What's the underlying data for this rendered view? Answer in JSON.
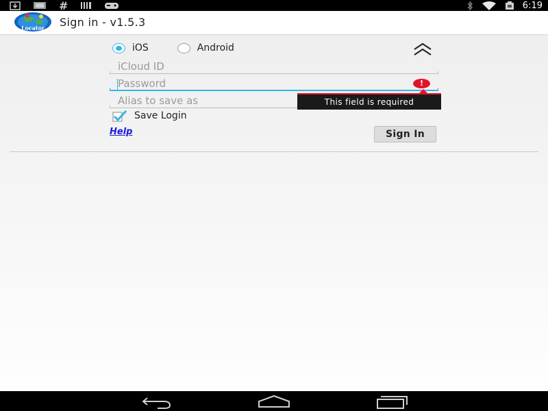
{
  "status_bar": {
    "time": "6:19",
    "left_icons": [
      "download-icon",
      "image-icon",
      "hash-icon",
      "barcode-icon",
      "gamepad-icon"
    ],
    "right_icons": [
      "bluetooth-icon",
      "wifi-icon",
      "battery-icon"
    ]
  },
  "action_bar": {
    "logo_icon": "locator-globe-icon",
    "logo_text": "Locator",
    "title": "Sign in - v1.5.3"
  },
  "form": {
    "platform_options": [
      {
        "label": "iOS",
        "selected": true
      },
      {
        "label": "Android",
        "selected": false
      }
    ],
    "icloud_id": {
      "placeholder": "iCloud ID",
      "value": ""
    },
    "password": {
      "placeholder": "Password",
      "value": "",
      "focused": true
    },
    "alias": {
      "placeholder": "Alias to save as",
      "value": ""
    },
    "error_message": "This field is required",
    "save_login": {
      "label": "Save Login",
      "checked": true
    },
    "help_link": "Help",
    "sign_in_label": "Sign In"
  },
  "nav_bar": {
    "buttons": [
      "back-icon",
      "home-icon",
      "recent-apps-icon"
    ]
  },
  "colors": {
    "accent": "#33b5e5",
    "error": "#e3132b",
    "link": "#1a1ae0"
  }
}
